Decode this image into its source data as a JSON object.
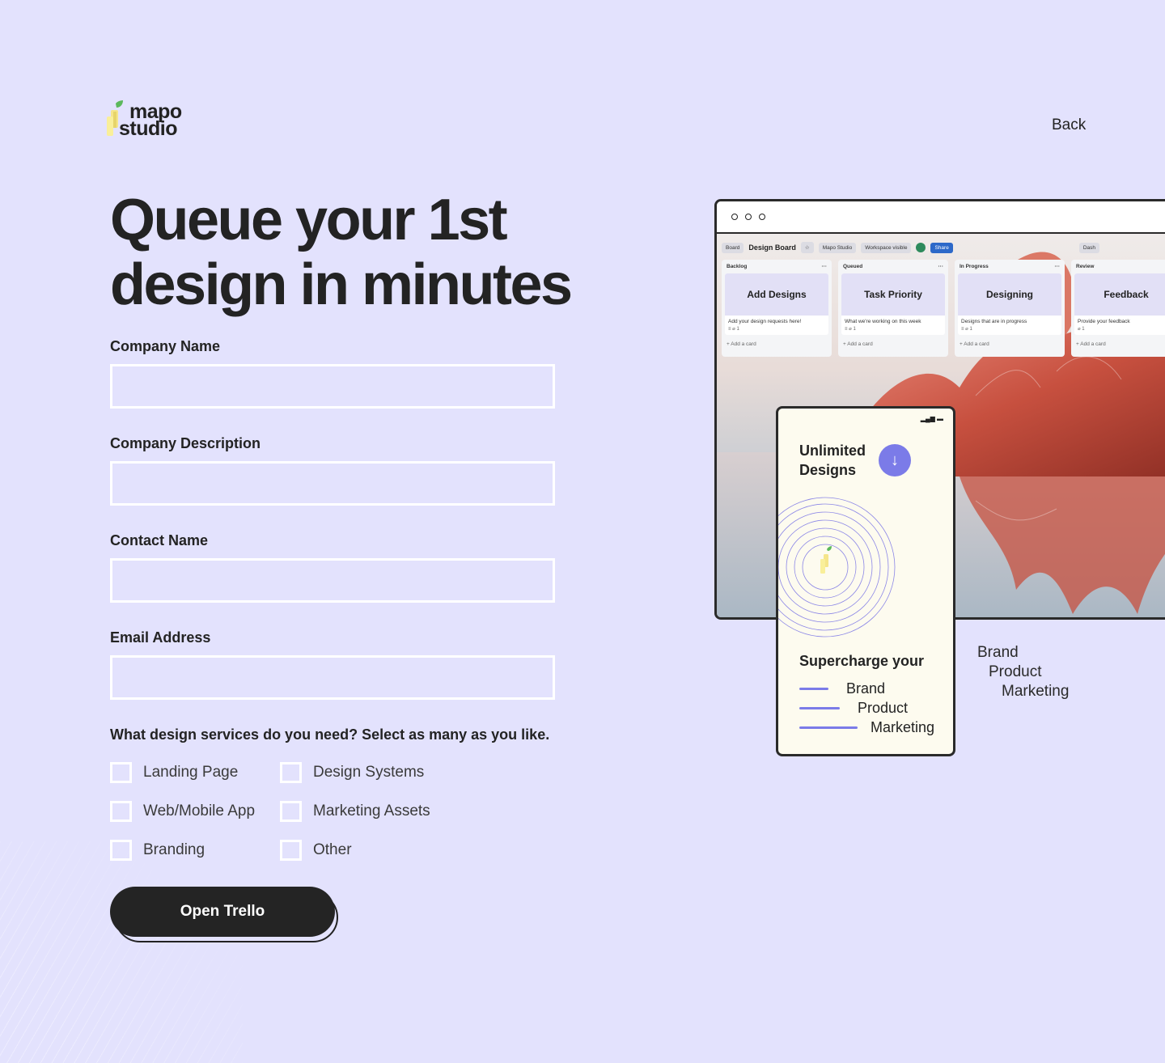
{
  "brand": {
    "line1": "mapo",
    "line2": "studio"
  },
  "nav": {
    "back_label": "Back"
  },
  "hero": {
    "line1": "Queue your 1st",
    "line2": "design in minutes"
  },
  "form": {
    "fields": [
      {
        "label": "Company Name",
        "value": "",
        "placeholder": ""
      },
      {
        "label": "Company Description",
        "value": "",
        "placeholder": ""
      },
      {
        "label": "Contact Name",
        "value": "",
        "placeholder": ""
      },
      {
        "label": "Email Address",
        "value": "",
        "placeholder": ""
      }
    ],
    "services_question": "What design services do you need? Select as many as you like.",
    "services": [
      {
        "label": "Landing Page",
        "checked": false
      },
      {
        "label": "Design Systems",
        "checked": false
      },
      {
        "label": "Web/Mobile App",
        "checked": false
      },
      {
        "label": "Marketing Assets",
        "checked": false
      },
      {
        "label": "Branding",
        "checked": false
      },
      {
        "label": "Other",
        "checked": false
      }
    ],
    "submit_label": "Open Trello"
  },
  "board_mock": {
    "view_chip": "Board",
    "title": "Design Board",
    "workspace_chip": "Mapo Studio",
    "visibility_chip": "Workspace visible",
    "share_label": "Share",
    "dash_label": "Dash",
    "columns": [
      {
        "name": "Backlog",
        "card_title": "Add Designs",
        "card_desc": "Add your design requests here!",
        "add_label": "+ Add a card"
      },
      {
        "name": "Queued",
        "card_title": "Task Priority",
        "card_desc": "What we're working on this week",
        "add_label": "+ Add a card"
      },
      {
        "name": "In Progress",
        "card_title": "Designing",
        "card_desc": "Designs that are in progress",
        "add_label": "+ Add a card"
      },
      {
        "name": "Review",
        "card_title": "Feedback",
        "card_desc": "Provide your feedback",
        "add_label": "+ Add a card"
      }
    ]
  },
  "phone_mock": {
    "headline_1": "Unlimited",
    "headline_2": "Designs",
    "tagline": "Supercharge your",
    "words": [
      "Brand",
      "Product",
      "Marketing"
    ]
  },
  "side_words": [
    "Brand",
    "Product",
    "Marketing"
  ],
  "colors": {
    "background": "#e3e2fd",
    "accent": "#7b7be8",
    "button": "#242424",
    "share": "#2d69c9"
  }
}
